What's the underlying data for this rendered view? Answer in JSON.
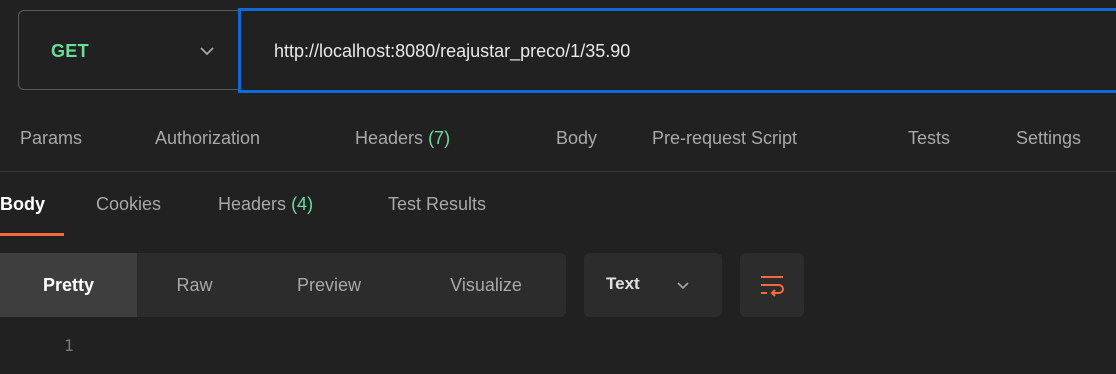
{
  "request": {
    "method": "GET",
    "url": "http://localhost:8080/reajustar_preco/1/35.90"
  },
  "request_tabs": {
    "params": "Params",
    "authorization": "Authorization",
    "headers": "Headers",
    "headers_count": "(7)",
    "body": "Body",
    "pre_request_script": "Pre-request Script",
    "tests": "Tests",
    "settings": "Settings"
  },
  "response_tabs": {
    "body": "Body",
    "cookies": "Cookies",
    "headers": "Headers",
    "headers_count": "(4)",
    "test_results": "Test Results",
    "active": "Body"
  },
  "view_modes": {
    "pretty": "Pretty",
    "raw": "Raw",
    "preview": "Preview",
    "visualize": "Visualize",
    "active": "Pretty"
  },
  "format": {
    "selected": "Text"
  },
  "editor": {
    "line_number": "1"
  },
  "icons": {
    "method_dropdown": "chevron-down-icon",
    "format_dropdown": "chevron-down-icon",
    "wrap": "word-wrap-icon"
  },
  "colors": {
    "method_get": "#6bdd9a",
    "url_focus_border": "#0e6ad6",
    "active_tab_underline": "#f26b3a",
    "count_badge": "#6bdd9a"
  }
}
